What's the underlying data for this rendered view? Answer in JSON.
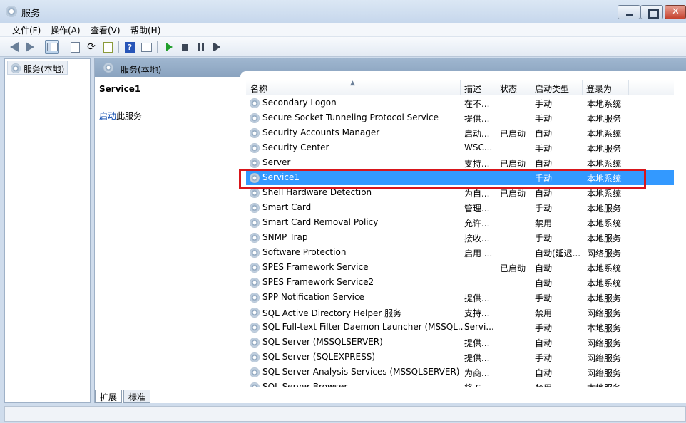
{
  "window": {
    "title": "服务"
  },
  "menu": [
    "文件(F)",
    "操作(A)",
    "查看(V)",
    "帮助(H)"
  ],
  "tree": {
    "root_label": "服务(本地)"
  },
  "main": {
    "header": "服务(本地)",
    "detail_title": "Service1",
    "detail_link": "启动",
    "detail_link_suffix": "此服务"
  },
  "columns": {
    "name": "名称",
    "desc": "描述",
    "status": "状态",
    "type": "启动类型",
    "logon": "登录为"
  },
  "services": [
    {
      "name": "Secondary Logon",
      "desc": "在不...",
      "status": "",
      "type": "手动",
      "logon": "本地系统"
    },
    {
      "name": "Secure Socket Tunneling Protocol Service",
      "desc": "提供...",
      "status": "",
      "type": "手动",
      "logon": "本地服务"
    },
    {
      "name": "Security Accounts Manager",
      "desc": "启动...",
      "status": "已启动",
      "type": "自动",
      "logon": "本地系统"
    },
    {
      "name": "Security Center",
      "desc": "WSC...",
      "status": "",
      "type": "手动",
      "logon": "本地服务"
    },
    {
      "name": "Server",
      "desc": "支持...",
      "status": "已启动",
      "type": "自动",
      "logon": "本地系统"
    },
    {
      "name": "Service1",
      "desc": "",
      "status": "",
      "type": "手动",
      "logon": "本地系统"
    },
    {
      "name": "Shell Hardware Detection",
      "desc": "为自...",
      "status": "已启动",
      "type": "自动",
      "logon": "本地系统"
    },
    {
      "name": "Smart Card",
      "desc": "管理...",
      "status": "",
      "type": "手动",
      "logon": "本地服务"
    },
    {
      "name": "Smart Card Removal Policy",
      "desc": "允许...",
      "status": "",
      "type": "禁用",
      "logon": "本地系统"
    },
    {
      "name": "SNMP Trap",
      "desc": "接收...",
      "status": "",
      "type": "手动",
      "logon": "本地服务"
    },
    {
      "name": "Software Protection",
      "desc": "启用 ...",
      "status": "",
      "type": "自动(延迟...",
      "logon": "网络服务"
    },
    {
      "name": "SPES Framework Service",
      "desc": "",
      "status": "已启动",
      "type": "自动",
      "logon": "本地系统"
    },
    {
      "name": "SPES Framework Service2",
      "desc": "",
      "status": "",
      "type": "自动",
      "logon": "本地系统"
    },
    {
      "name": "SPP Notification Service",
      "desc": "提供...",
      "status": "",
      "type": "手动",
      "logon": "本地服务"
    },
    {
      "name": "SQL Active Directory Helper 服务",
      "desc": "支持...",
      "status": "",
      "type": "禁用",
      "logon": "网络服务"
    },
    {
      "name": "SQL Full-text Filter Daemon Launcher (MSSQL...",
      "desc": "Servi...",
      "status": "",
      "type": "手动",
      "logon": "本地服务"
    },
    {
      "name": "SQL Server (MSSQLSERVER)",
      "desc": "提供...",
      "status": "",
      "type": "自动",
      "logon": "网络服务"
    },
    {
      "name": "SQL Server (SQLEXPRESS)",
      "desc": "提供...",
      "status": "",
      "type": "手动",
      "logon": "网络服务"
    },
    {
      "name": "SQL Server Analysis Services (MSSQLSERVER)",
      "desc": "为商...",
      "status": "",
      "type": "自动",
      "logon": "网络服务"
    },
    {
      "name": "SQL Server Browser",
      "desc": "将 S...",
      "status": "",
      "type": "禁用",
      "logon": "本地服务"
    }
  ],
  "selected_service": "Service1",
  "bottom_tabs": [
    "扩展",
    "标准"
  ],
  "colors": {
    "selection": "#3399ff",
    "highlight_box": "#d8161b",
    "link": "#0645ad"
  },
  "icons": [
    "back-arrow-icon",
    "forward-arrow-icon",
    "console-tree-icon",
    "properties-icon",
    "refresh-icon",
    "export-list-icon",
    "help-icon",
    "show-hide-icon",
    "start-service-icon",
    "stop-service-icon",
    "pause-service-icon",
    "restart-service-icon",
    "service-gear-icon"
  ]
}
